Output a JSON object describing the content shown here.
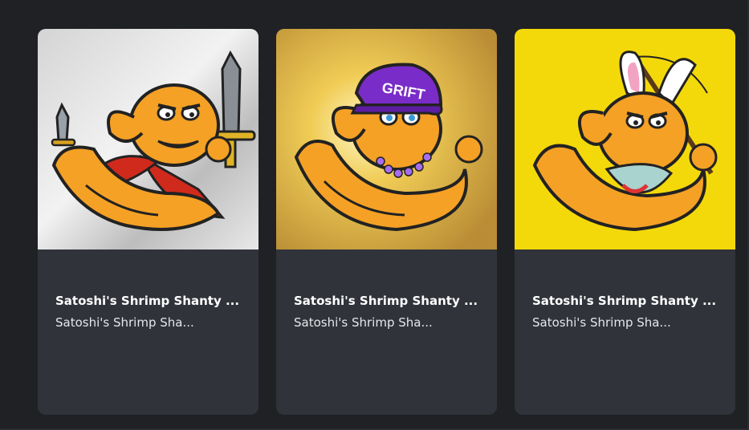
{
  "cards": [
    {
      "title": "Satoshi's Shrimp Shanty ...",
      "subtitle": "Satoshi's Shrimp Sha...",
      "image": "shrimp-knight-swords-image",
      "background_color": "#c9c9c9"
    },
    {
      "title": "Satoshi's Shrimp Shanty ...",
      "subtitle": "Satoshi's Shrimp Sha...",
      "image": "shrimp-grift-cap-image",
      "cap_text": "GRIFT",
      "background_color": "#c8a13c"
    },
    {
      "title": "Satoshi's Shrimp Shanty ...",
      "subtitle": "Satoshi's Shrimp Sha...",
      "image": "shrimp-bunny-ears-fishing-image",
      "background_color": "#f4d90a"
    }
  ],
  "more_icon": "ellipsis-icon",
  "colors": {
    "page_background": "#202125",
    "card_background": "#303339",
    "more_dots": "#9aa0ac"
  }
}
